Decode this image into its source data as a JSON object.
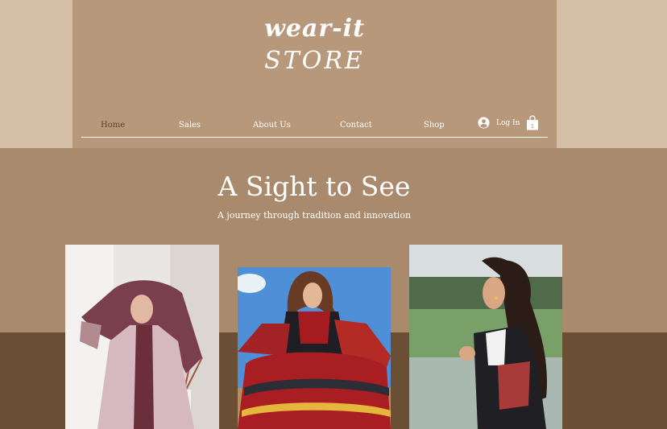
{
  "brand": {
    "line1": "wear-it",
    "line2": "STORE"
  },
  "nav": {
    "items": [
      {
        "label": "Home",
        "active": true
      },
      {
        "label": "Sales"
      },
      {
        "label": "About Us"
      },
      {
        "label": "Contact"
      },
      {
        "label": "Shop"
      }
    ],
    "login_label": "Log In",
    "cart_count": "1"
  },
  "hero": {
    "title": "A Sight to See",
    "subtitle": "A journey through tradition and innovation"
  },
  "gallery": {
    "images": [
      {
        "name": "woman-in-mauve-headscarf-photo"
      },
      {
        "name": "woman-in-red-embroidered-dress-photo"
      },
      {
        "name": "woman-in-embroidered-black-top-photo"
      }
    ]
  },
  "colors": {
    "header_bg": "#b7987a",
    "mid_band": "#a98a6c",
    "bottom_band": "#6b4f35",
    "active_nav": "#5a4532"
  }
}
